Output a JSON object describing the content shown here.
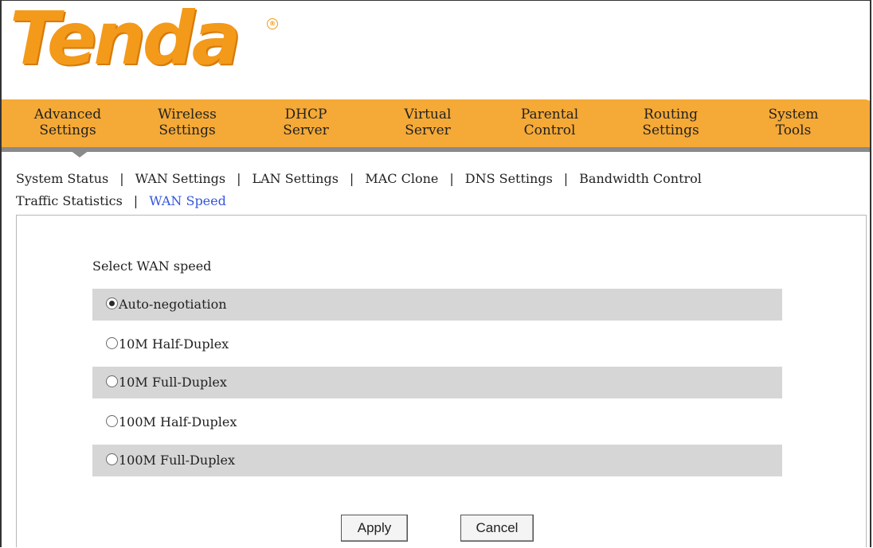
{
  "brand": {
    "logo_text": "Tenda"
  },
  "main_nav": [
    {
      "line1": "Advanced",
      "line2": "Settings"
    },
    {
      "line1": "Wireless",
      "line2": "Settings"
    },
    {
      "line1": "DHCP",
      "line2": "Server"
    },
    {
      "line1": "Virtual",
      "line2": "Server"
    },
    {
      "line1": "Parental",
      "line2": "Control"
    },
    {
      "line1": "Routing",
      "line2": "Settings"
    },
    {
      "line1": "System",
      "line2": "Tools"
    }
  ],
  "sub_nav": {
    "items": [
      "System Status",
      "WAN Settings",
      "LAN Settings",
      "MAC Clone",
      "DNS Settings",
      "Bandwidth Control",
      "Traffic Statistics",
      "WAN Speed"
    ],
    "separator": "|",
    "active_color": "#3355dd"
  },
  "form": {
    "title": "Select WAN speed",
    "options": [
      "Auto-negotiation",
      "10M Half-Duplex",
      "10M Full-Duplex",
      "100M Half-Duplex",
      "100M Full-Duplex"
    ],
    "selected": "Auto-negotiation"
  },
  "buttons": {
    "apply": "Apply",
    "cancel": "Cancel"
  },
  "colors": {
    "nav_bg": "#f5a936",
    "logo": "#f39a1a",
    "row_shade": "#d6d6d6"
  }
}
